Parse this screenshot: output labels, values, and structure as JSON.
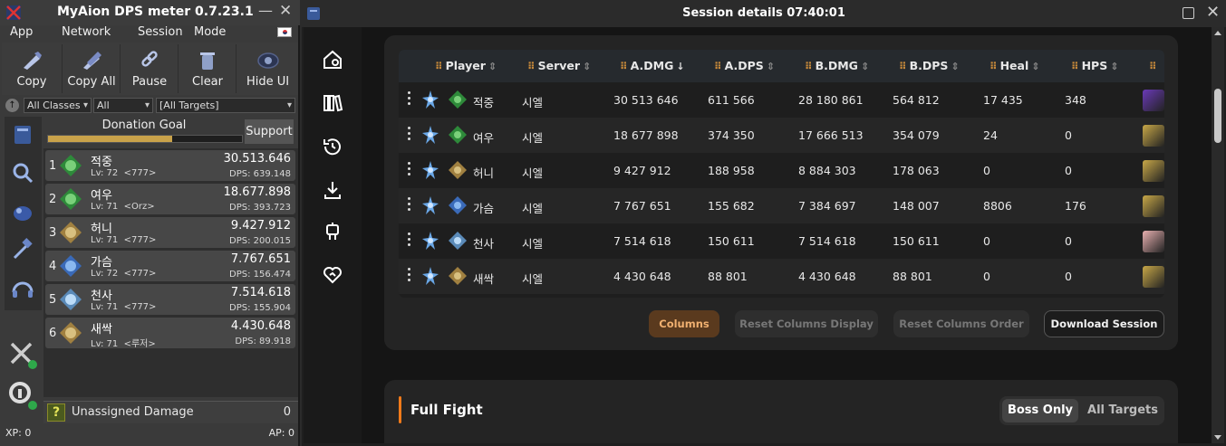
{
  "left_window": {
    "title": "MyAion DPS meter 0.7.23.1",
    "minimize": "—",
    "close": "✕",
    "menu": [
      "App",
      "Network",
      "Session",
      "Mode"
    ],
    "toolbar": [
      "Copy",
      "Copy All",
      "Pause",
      "Clear",
      "Hide UI"
    ],
    "filters": {
      "classes": "All Classes",
      "scope": "All",
      "targets": "[All Targets]"
    },
    "donation": {
      "label": "Donation Goal",
      "progress": 0.64
    },
    "support_label": "Support",
    "players": [
      {
        "rank": "1",
        "name": "적중",
        "level": "Lv: 72",
        "server": "<777>",
        "damage": "30.513.646",
        "dps": "DPS: 639.148"
      },
      {
        "rank": "2",
        "name": "여우",
        "level": "Lv: 71",
        "server": "<Orz>",
        "damage": "18.677.898",
        "dps": "DPS: 393.723"
      },
      {
        "rank": "3",
        "name": "허니",
        "level": "Lv: 71",
        "server": "<777>",
        "damage": "9.427.912",
        "dps": "DPS: 200.015"
      },
      {
        "rank": "4",
        "name": "가슴",
        "level": "Lv: 72",
        "server": "<777>",
        "damage": "7.767.651",
        "dps": "DPS: 156.474"
      },
      {
        "rank": "5",
        "name": "천사",
        "level": "Lv: 71",
        "server": "<777>",
        "damage": "7.514.618",
        "dps": "DPS: 155.904"
      },
      {
        "rank": "6",
        "name": "새싹",
        "level": "Lv: 71",
        "server": "<루저>",
        "damage": "4.430.648",
        "dps": "DPS: 89.918"
      }
    ],
    "unassigned": {
      "label": "Unassigned Damage",
      "value": "0"
    },
    "status": {
      "xp": "XP: 0",
      "ap": "AP: 0"
    }
  },
  "right_window": {
    "title": "Session details 07:40:01",
    "close": "✕",
    "columns": [
      "Player",
      "Server",
      "A.DMG",
      "A.DPS",
      "B.DMG",
      "B.DPS",
      "Heal",
      "HPS"
    ],
    "sort_column": "A.DMG",
    "rows": [
      {
        "player": "적중",
        "server": "시엘",
        "admg": "30 513 646",
        "adps": "611 566",
        "bdmg": "28 180 861",
        "bdps": "564 812",
        "heal": "17 435",
        "hps": "348"
      },
      {
        "player": "여우",
        "server": "시엘",
        "admg": "18 677 898",
        "adps": "374 350",
        "bdmg": "17 666 513",
        "bdps": "354 079",
        "heal": "24",
        "hps": "0"
      },
      {
        "player": "허니",
        "server": "시엘",
        "admg": "9 427 912",
        "adps": "188 958",
        "bdmg": "8 884 303",
        "bdps": "178 063",
        "heal": "0",
        "hps": "0"
      },
      {
        "player": "가슴",
        "server": "시엘",
        "admg": "7 767 651",
        "adps": "155 682",
        "bdmg": "7 384 697",
        "bdps": "148 007",
        "heal": "8806",
        "hps": "176"
      },
      {
        "player": "천사",
        "server": "시엘",
        "admg": "7 514 618",
        "adps": "150 611",
        "bdmg": "7 514 618",
        "bdps": "150 611",
        "heal": "0",
        "hps": "0"
      },
      {
        "player": "새싹",
        "server": "시엘",
        "admg": "4 430 648",
        "adps": "88 801",
        "bdmg": "4 430 648",
        "bdps": "88 801",
        "heal": "0",
        "hps": "0"
      }
    ],
    "buttons": {
      "columns": "Columns",
      "reset_display": "Reset Columns Display",
      "reset_order": "Reset Columns Order",
      "download": "Download Session"
    },
    "full_fight": {
      "title": "Full Fight",
      "boss_only": "Boss Only",
      "all_targets": "All Targets"
    }
  }
}
